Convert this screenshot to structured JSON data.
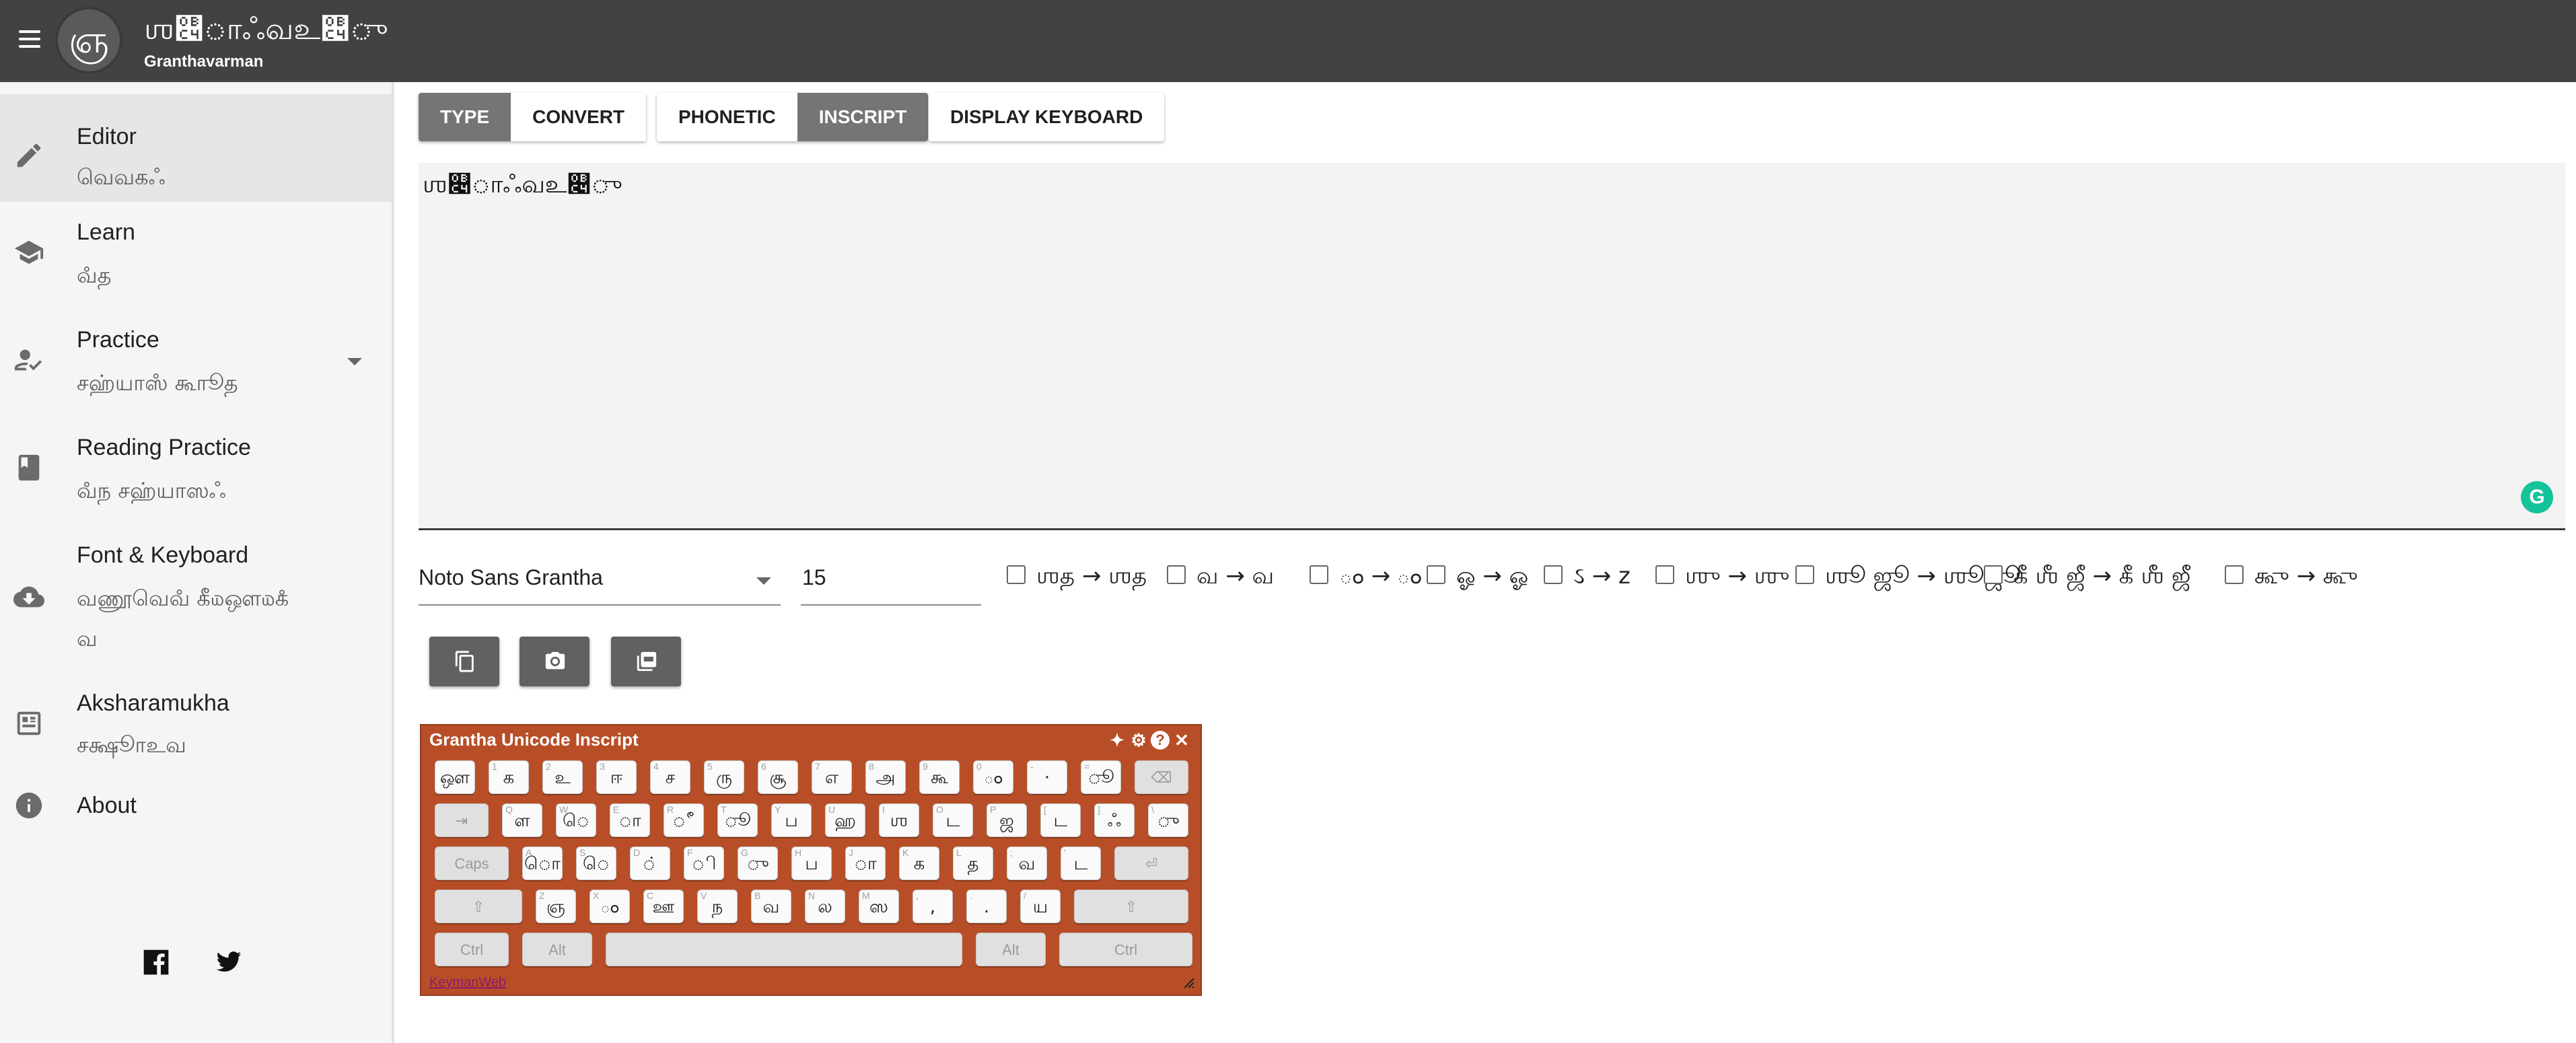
{
  "header": {
    "logo_text": "ஞ",
    "title": "ஶ௄ாஃவஉ௄ு",
    "subtitle": "Granthavarman"
  },
  "sidebar": {
    "items": [
      {
        "label": "Editor",
        "sub": "வெவகஃ"
      },
      {
        "label": "Learn",
        "sub": "வஂத"
      },
      {
        "label": "Practice",
        "sub": "சஹ்யாஸஂ கூாூத"
      },
      {
        "label": "Reading Practice",
        "sub": "வஂந சஹ்யாஸஃ"
      },
      {
        "label": "Font & Keyboard",
        "sub_line1": "வணூவெவஂ கீ௰ஔ௰கஂ",
        "sub_line2": "வ"
      },
      {
        "label": "Aksharamukha",
        "sub": "சக்ஷூாஉவ"
      },
      {
        "label": "About"
      }
    ]
  },
  "toolbar": {
    "mode_type": "TYPE",
    "mode_convert": "CONVERT",
    "scheme_phonetic": "PHONETIC",
    "scheme_inscript": "INSCRIPT",
    "display_keyboard": "DISPLAY KEYBOARD"
  },
  "editor": {
    "text": "ஶ௄ாஃவஉ௄ு"
  },
  "settings": {
    "font": "Noto Sans Grantha",
    "size": "15"
  },
  "options": [
    {
      "label": "ஶத → ஶத",
      "checked": false
    },
    {
      "label": "வ → வ",
      "checked": false
    },
    {
      "label": "ం → ం",
      "checked": false
    },
    {
      "label": "ஓ → ஓ",
      "checked": false
    },
    {
      "label": "ઽ → z",
      "checked": false
    },
    {
      "label": "ஶு → ஶு",
      "checked": false
    },
    {
      "label": "ஶூ ஜூ → ஶூஜூ",
      "checked": false
    },
    {
      "label": "கீ ஶீ ஜீ → கீ ஶீ ஜீ",
      "checked": false
    },
    {
      "label": "கூு → கூு",
      "checked": false
    }
  ],
  "icons": {
    "copy": "copy-icon",
    "camera": "camera-icon",
    "pdf": "pdf-icon"
  },
  "keyboard": {
    "title": "Grantha Unicode Inscript",
    "link": "KeymanWeb",
    "row1": [
      [
        "",
        "ஔ"
      ],
      [
        "1",
        "க"
      ],
      [
        "2",
        "உ"
      ],
      [
        "3",
        "ஈ"
      ],
      [
        "4",
        "ச"
      ],
      [
        "5",
        "ரு"
      ],
      [
        "6",
        "சூ"
      ],
      [
        "7",
        "எ"
      ],
      [
        "8",
        "அ"
      ],
      [
        "9",
        "கூ"
      ],
      [
        "0",
        "ం"
      ],
      [
        "-",
        "·"
      ],
      [
        "=",
        "ூ"
      ]
    ],
    "row2": [
      [
        "Q",
        "ள"
      ],
      [
        "W",
        "ெ"
      ],
      [
        "E",
        "ா"
      ],
      [
        "R",
        "ீ"
      ],
      [
        "T",
        "ூ"
      ],
      [
        "Y",
        "ப"
      ],
      [
        "U",
        "ஹ"
      ],
      [
        "I",
        "ஶ"
      ],
      [
        "O",
        "ட"
      ],
      [
        "P",
        "ஜ"
      ],
      [
        "[",
        "ட"
      ],
      [
        "]",
        "ஃ"
      ],
      [
        "\\",
        "ு"
      ]
    ],
    "row3": [
      [
        "A",
        "ொ"
      ],
      [
        "S",
        "ெ"
      ],
      [
        "D",
        "்"
      ],
      [
        "F",
        "ி"
      ],
      [
        "G",
        "ு"
      ],
      [
        "H",
        "ப"
      ],
      [
        "J",
        "ா"
      ],
      [
        "K",
        "க"
      ],
      [
        "L",
        "த"
      ],
      [
        ";",
        "வ"
      ],
      [
        "'",
        "ட"
      ]
    ],
    "row4": [
      [
        "Z",
        "ஞ"
      ],
      [
        "X",
        "ం"
      ],
      [
        "C",
        "ஊ"
      ],
      [
        "V",
        "ந"
      ],
      [
        "B",
        "வ"
      ],
      [
        "N",
        "ல"
      ],
      [
        "M",
        "ஸ"
      ],
      [
        ",",
        ","
      ],
      [
        ".",
        "."
      ],
      [
        "/",
        "ய"
      ]
    ],
    "caps": "Caps",
    "ctrl": "Ctrl",
    "alt": "Alt",
    "backspace": "⌫",
    "tab": "⇥",
    "enter": "⏎",
    "shift": "⇧",
    "tool_pin": "✦",
    "tool_settings": "⚙",
    "tool_help": "?",
    "tool_close": "✕"
  }
}
